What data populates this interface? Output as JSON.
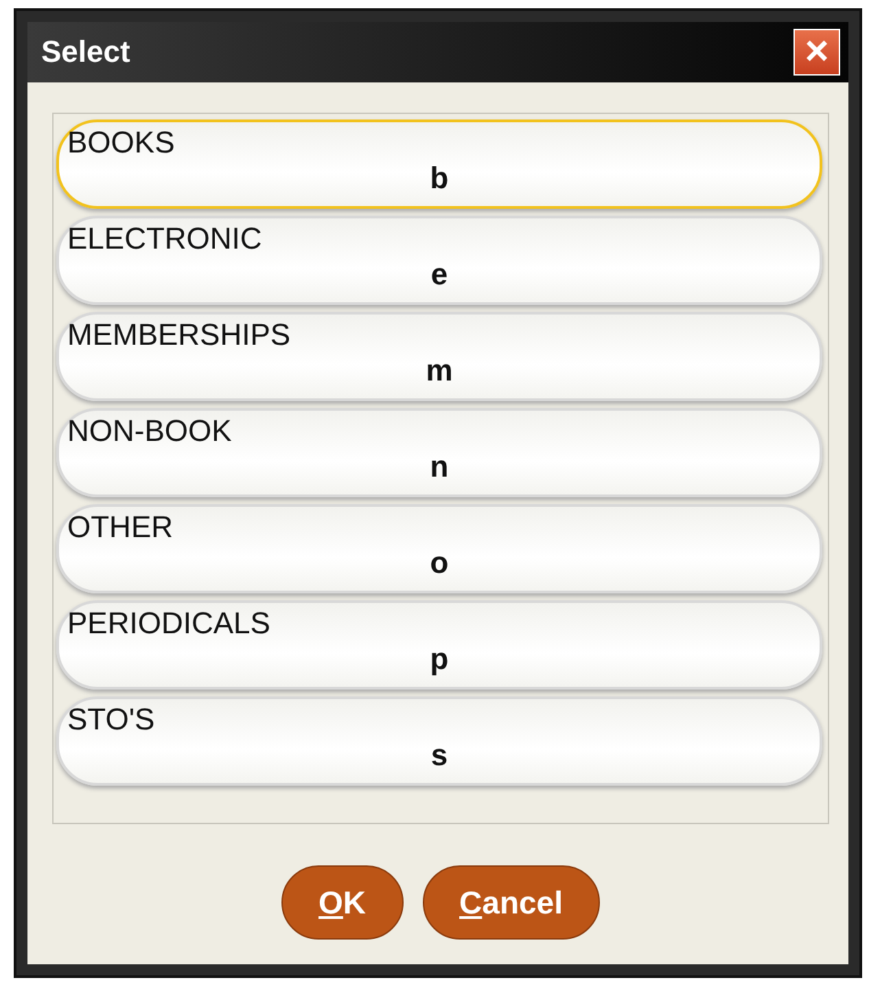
{
  "window": {
    "title": "Select",
    "close": "×"
  },
  "items": [
    {
      "label": "BOOKS",
      "code": "b",
      "selected": true
    },
    {
      "label": "ELECTRONIC",
      "code": "e",
      "selected": false
    },
    {
      "label": "MEMBERSHIPS",
      "code": "m",
      "selected": false
    },
    {
      "label": "NON-BOOK",
      "code": "n",
      "selected": false
    },
    {
      "label": "OTHER",
      "code": "o",
      "selected": false
    },
    {
      "label": "PERIODICALS",
      "code": "p",
      "selected": false
    },
    {
      "label": "STO'S",
      "code": "s",
      "selected": false
    }
  ],
  "buttons": [
    {
      "mnemonic": "O",
      "rest": "K"
    },
    {
      "mnemonic": "C",
      "rest": "ancel"
    }
  ]
}
